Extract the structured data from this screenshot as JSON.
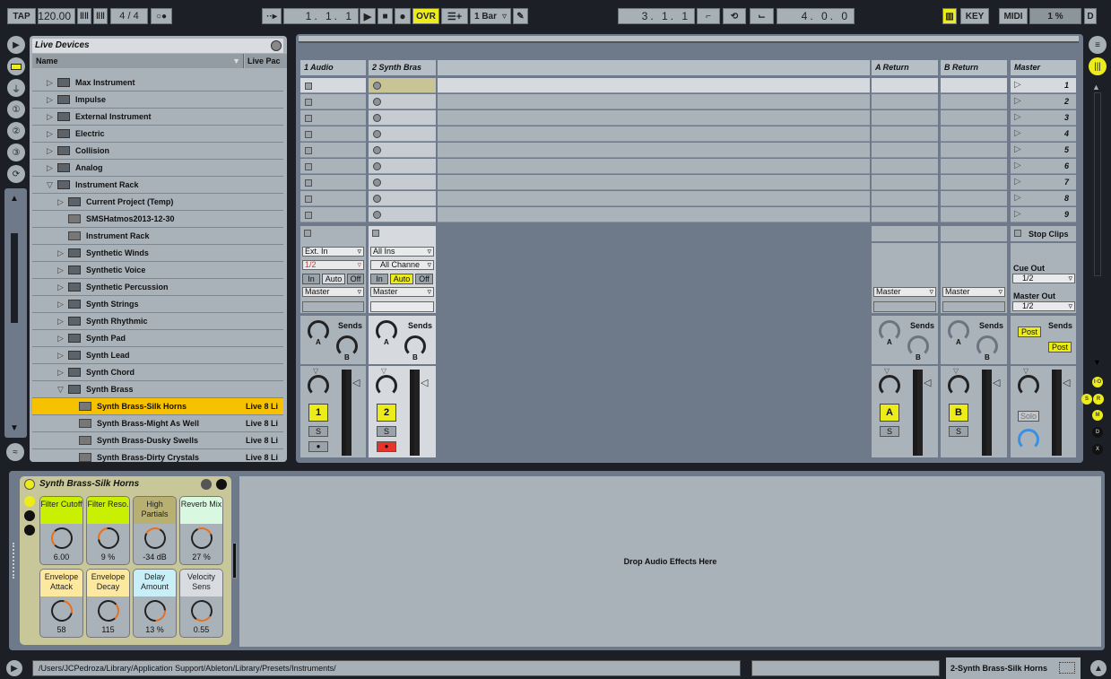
{
  "transport": {
    "tap": "TAP",
    "tempo": "120.00",
    "signature": "4 / 4",
    "position": "1. 1. 1",
    "ovr": "OVR",
    "quantize": "1 Bar",
    "loop_start": "3. 1. 1",
    "loop_length": "4. 0. 0",
    "key": "KEY",
    "midi": "MIDI",
    "cpu": "1 %",
    "d": "D"
  },
  "browser": {
    "title": "Live Devices",
    "col_name": "Name",
    "col_pack": "Live Pac",
    "items": [
      {
        "label": "Max Instrument",
        "indent": 0,
        "arrow": "▷",
        "folder": true
      },
      {
        "label": "Impulse",
        "indent": 0,
        "arrow": "▷",
        "folder": true
      },
      {
        "label": "External Instrument",
        "indent": 0,
        "arrow": "▷",
        "folder": true
      },
      {
        "label": "Electric",
        "indent": 0,
        "arrow": "▷",
        "folder": true
      },
      {
        "label": "Collision",
        "indent": 0,
        "arrow": "▷",
        "folder": true
      },
      {
        "label": "Analog",
        "indent": 0,
        "arrow": "▷",
        "folder": true
      },
      {
        "label": "Instrument Rack",
        "indent": 0,
        "arrow": "▽",
        "folder": true
      },
      {
        "label": "Current Project (Temp)",
        "indent": 1,
        "arrow": "▷",
        "folder": true
      },
      {
        "label": "SMSHatmos2013-12-30",
        "indent": 1,
        "arrow": "",
        "folder": false
      },
      {
        "label": "Instrument Rack",
        "indent": 1,
        "arrow": "",
        "folder": false
      },
      {
        "label": "Synthetic Winds",
        "indent": 1,
        "arrow": "▷",
        "folder": true
      },
      {
        "label": "Synthetic Voice",
        "indent": 1,
        "arrow": "▷",
        "folder": true
      },
      {
        "label": "Synthetic Percussion",
        "indent": 1,
        "arrow": "▷",
        "folder": true
      },
      {
        "label": "Synth Strings",
        "indent": 1,
        "arrow": "▷",
        "folder": true
      },
      {
        "label": "Synth Rhythmic",
        "indent": 1,
        "arrow": "▷",
        "folder": true
      },
      {
        "label": "Synth Pad",
        "indent": 1,
        "arrow": "▷",
        "folder": true
      },
      {
        "label": "Synth Lead",
        "indent": 1,
        "arrow": "▷",
        "folder": true
      },
      {
        "label": "Synth Chord",
        "indent": 1,
        "arrow": "▷",
        "folder": true
      },
      {
        "label": "Synth Brass",
        "indent": 1,
        "arrow": "▽",
        "folder": true
      },
      {
        "label": "Synth Brass-Silk Horns",
        "indent": 2,
        "arrow": "",
        "folder": false,
        "pack": "Live 8 Li",
        "selected": true
      },
      {
        "label": "Synth Brass-Might As Well",
        "indent": 2,
        "arrow": "",
        "folder": false,
        "pack": "Live 8 Li"
      },
      {
        "label": "Synth Brass-Dusky Swells",
        "indent": 2,
        "arrow": "",
        "folder": false,
        "pack": "Live 8 Li"
      },
      {
        "label": "Synth Brass-Dirty Crystals",
        "indent": 2,
        "arrow": "",
        "folder": false,
        "pack": "Live 8 Li"
      }
    ]
  },
  "tracks": {
    "audio": "1 Audio",
    "synth": "2 Synth Bras",
    "a_return": "A Return",
    "b_return": "B Return",
    "master": "Master"
  },
  "scenes": [
    "1",
    "2",
    "3",
    "4",
    "5",
    "6",
    "7",
    "8",
    "9"
  ],
  "mixer": {
    "ext_in": "Ext. In",
    "ch_12": "1/2",
    "all_ins": "All Ins",
    "all_channels": "All Channe",
    "in": "In",
    "auto": "Auto",
    "off": "Off",
    "master": "Master",
    "sends": "Sends",
    "a": "A",
    "b": "B",
    "stop_clips": "Stop Clips",
    "cue_out": "Cue Out",
    "cue_val": "1/2",
    "master_out": "Master Out",
    "master_val": "1/2",
    "post": "Post",
    "solo": "Solo",
    "s": "S",
    "num1": "1",
    "num2": "2",
    "numA": "A",
    "numB": "B"
  },
  "device": {
    "title": "Synth Brass-Silk Horns",
    "macros": [
      {
        "label": "Filter Cutoff",
        "value": "6.00",
        "color": "#c8f000"
      },
      {
        "label": "Filter Reso.",
        "value": "9 %",
        "color": "#c8f000"
      },
      {
        "label": "High Partials",
        "value": "-34 dB",
        "color": "#b8b070"
      },
      {
        "label": "Reverb Mix",
        "value": "27 %",
        "color": "#d8f8e0"
      },
      {
        "label": "Envelope Attack",
        "value": "58",
        "color": "#fde8a0"
      },
      {
        "label": "Envelope Decay",
        "value": "115",
        "color": "#fde8a0"
      },
      {
        "label": "Delay Amount",
        "value": "13 %",
        "color": "#c8eef8"
      },
      {
        "label": "Velocity Sens",
        "value": "0.55",
        "color": "#d8dce0"
      }
    ]
  },
  "drop_text": "Drop Audio Effects Here",
  "status": {
    "path": "/Users/JCPedroza/Library/Application Support/Ableton/Library/Presets/Instruments/",
    "track": "2-Synth Brass-Silk Horns"
  },
  "right_buttons": [
    "I·O",
    "S",
    "R",
    "M",
    "D",
    "X"
  ]
}
